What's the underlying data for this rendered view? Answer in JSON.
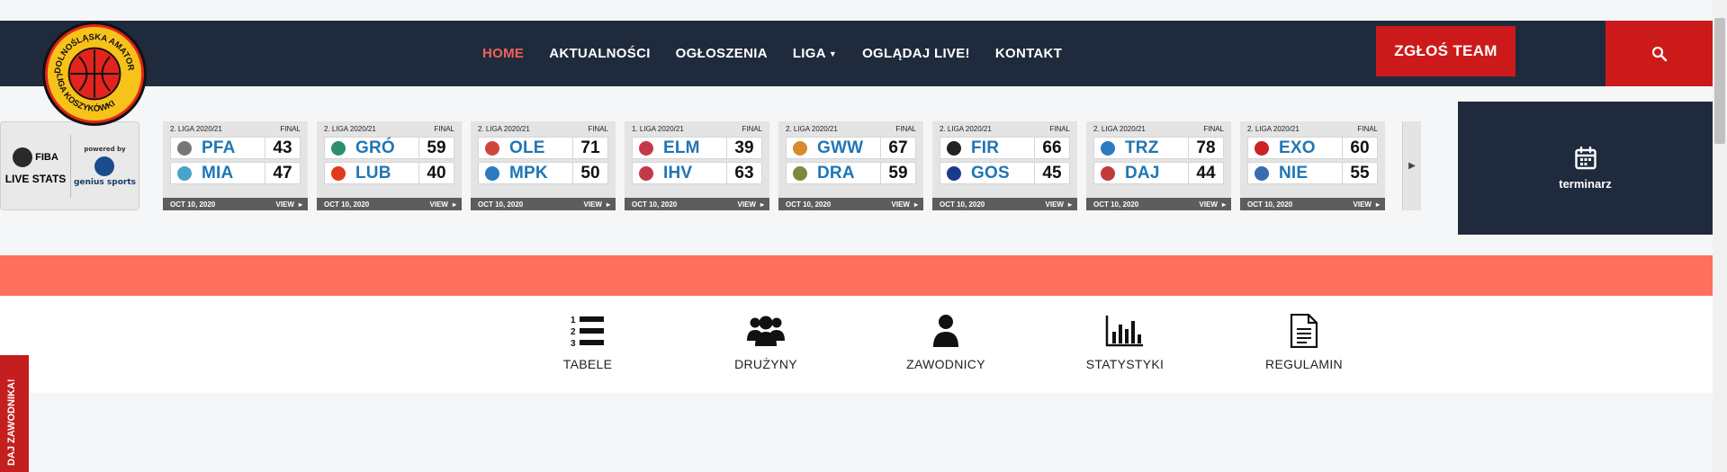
{
  "brand": {
    "logo_text_top": "DOLNOŚLĄSKA AMATORSKA",
    "logo_text_bottom": "LIGA KOSZYKÓWKI"
  },
  "nav": {
    "items": [
      {
        "label": "HOME",
        "active": true
      },
      {
        "label": "AKTUALNOŚCI"
      },
      {
        "label": "OGŁOSZENIA"
      },
      {
        "label": "LIGA",
        "dropdown": true
      },
      {
        "label": "OGLĄDAJ LIVE!"
      },
      {
        "label": "KONTAKT"
      }
    ],
    "cta_label": "ZGŁOŚ TEAM",
    "search_icon": "search-icon"
  },
  "colors": {
    "navy": "#1f2a3d",
    "red": "#cc1a1a",
    "salmon": "#ff6f5d",
    "team_blue": "#1f76b5"
  },
  "fiba_widget": {
    "fiba_label": "FIBA",
    "live_stats": "LIVE STATS",
    "powered_by": "powered by",
    "genius": "genius sports"
  },
  "games": [
    {
      "league": "2. LIGA 2020/21",
      "status": "FINAL",
      "home": {
        "abbr": "PFA",
        "score": "43"
      },
      "away": {
        "abbr": "MIA",
        "score": "47"
      },
      "date": "OCT 10, 2020",
      "view": "VIEW"
    },
    {
      "league": "2. LIGA 2020/21",
      "status": "FINAL",
      "home": {
        "abbr": "GRÓ",
        "score": "59"
      },
      "away": {
        "abbr": "LUB",
        "score": "40"
      },
      "date": "OCT 10, 2020",
      "view": "VIEW"
    },
    {
      "league": "2. LIGA 2020/21",
      "status": "FINAL",
      "home": {
        "abbr": "OLE",
        "score": "71"
      },
      "away": {
        "abbr": "MPK",
        "score": "50"
      },
      "date": "OCT 10, 2020",
      "view": "VIEW"
    },
    {
      "league": "1. LIGA 2020/21",
      "status": "FINAL",
      "home": {
        "abbr": "ELM",
        "score": "39"
      },
      "away": {
        "abbr": "IHV",
        "score": "63"
      },
      "date": "OCT 10, 2020",
      "view": "VIEW"
    },
    {
      "league": "2. LIGA 2020/21",
      "status": "FINAL",
      "home": {
        "abbr": "GWW",
        "score": "67"
      },
      "away": {
        "abbr": "DRA",
        "score": "59"
      },
      "date": "OCT 10, 2020",
      "view": "VIEW"
    },
    {
      "league": "2. LIGA 2020/21",
      "status": "FINAL",
      "home": {
        "abbr": "FIR",
        "score": "66"
      },
      "away": {
        "abbr": "GOS",
        "score": "45"
      },
      "date": "OCT 10, 2020",
      "view": "VIEW"
    },
    {
      "league": "2. LIGA 2020/21",
      "status": "FINAL",
      "home": {
        "abbr": "TRZ",
        "score": "78"
      },
      "away": {
        "abbr": "DAJ",
        "score": "44"
      },
      "date": "OCT 10, 2020",
      "view": "VIEW"
    },
    {
      "league": "2. LIGA 2020/21",
      "status": "FINAL",
      "home": {
        "abbr": "EXO",
        "score": "60"
      },
      "away": {
        "abbr": "NIE",
        "score": "55"
      },
      "date": "OCT 10, 2020",
      "view": "VIEW"
    }
  ],
  "schedule_tile": {
    "label": "terminarz",
    "icon": "calendar-icon"
  },
  "quick_links": [
    {
      "label": "TABELE",
      "icon": "ordered-list-icon"
    },
    {
      "label": "DRUŻYNY",
      "icon": "users-group-icon"
    },
    {
      "label": "ZAWODNICY",
      "icon": "user-icon"
    },
    {
      "label": "STATYSTYKI",
      "icon": "bar-chart-icon"
    },
    {
      "label": "REGULAMIN",
      "icon": "document-icon"
    }
  ],
  "side_tab": {
    "label": "DAJ ZAWODNIKA!"
  }
}
